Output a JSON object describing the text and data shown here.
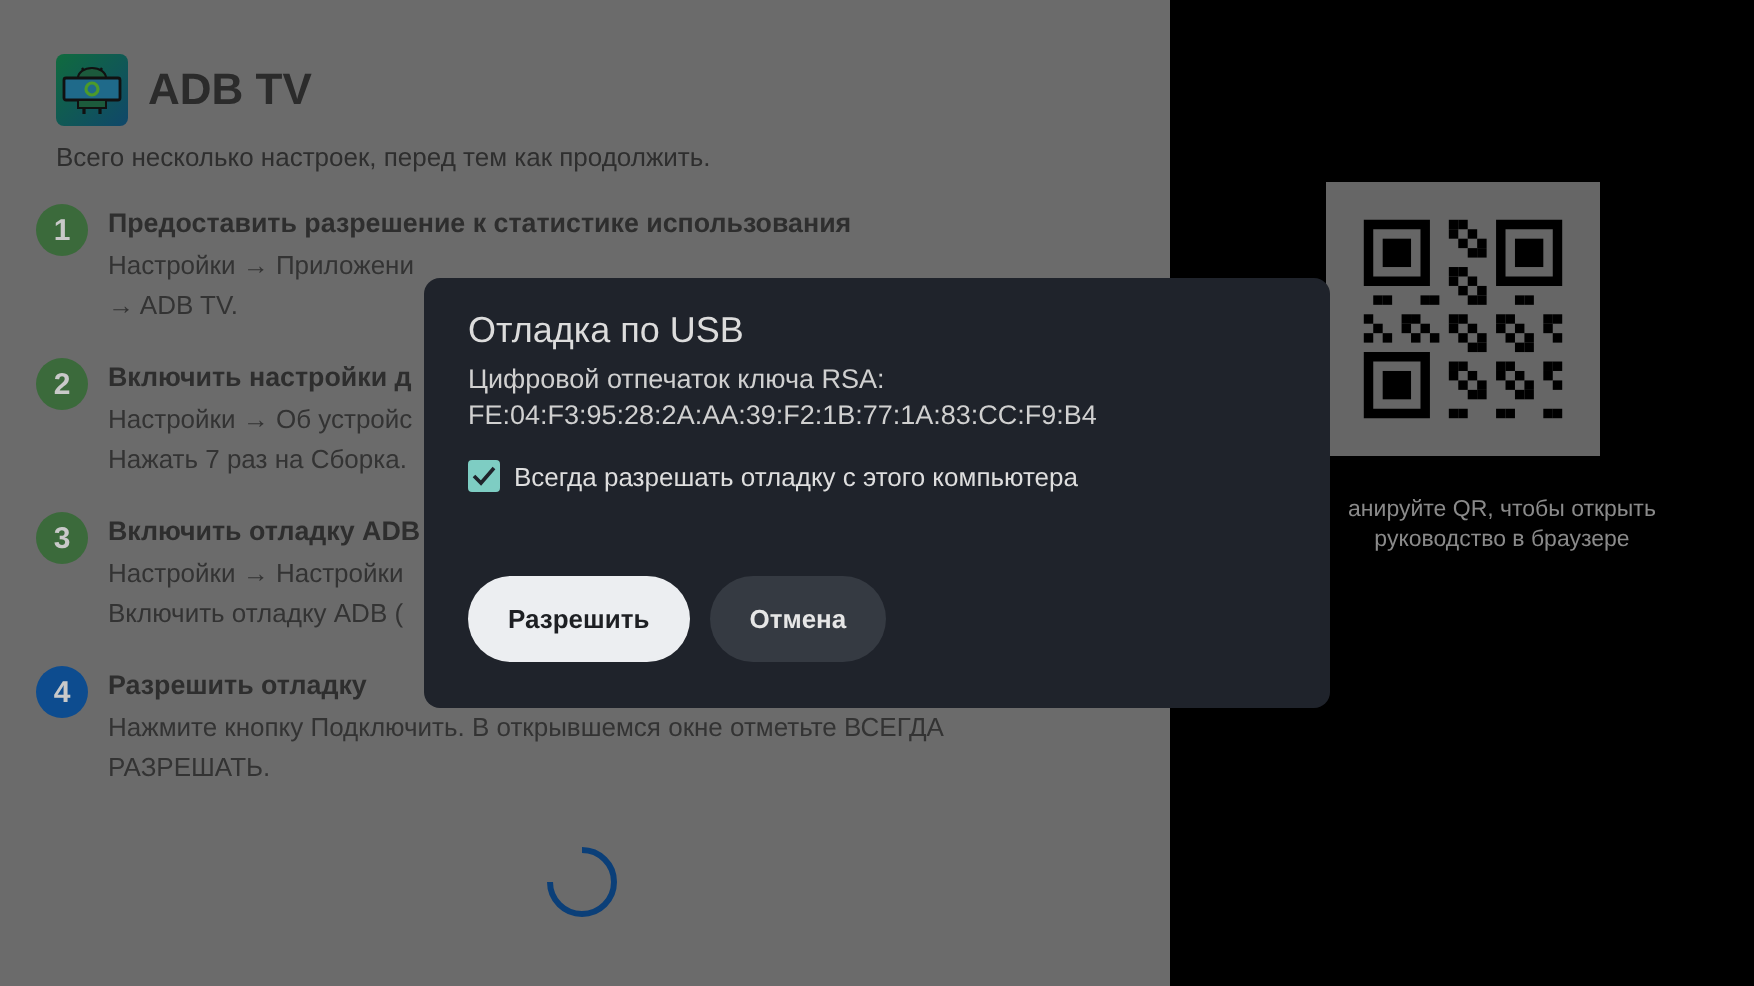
{
  "app": {
    "title": "ADB TV",
    "subtitle": "Всего несколько настроек, перед тем как продолжить."
  },
  "steps": [
    {
      "number": "1",
      "color": "#3b6a3b",
      "title": "Предоставить разрешение к статистике использования",
      "lines": [
        "Настройки → Приложени",
        "→ ADB TV."
      ]
    },
    {
      "number": "2",
      "color": "#3b6a3b",
      "title": "Включить настройки д",
      "lines": [
        "Настройки → Об устройс",
        "Нажать 7 раз на Сборка."
      ]
    },
    {
      "number": "3",
      "color": "#3b6a3b",
      "title": "Включить отладку ADB",
      "lines": [
        "Настройки → Настройки",
        "Включить отладку ADB ("
      ]
    },
    {
      "number": "4",
      "color": "#0d4c8f",
      "title": "Разрешить отладку",
      "lines": [
        "Нажмите кнопку Подключить. В открывшемся окне отметьте ВСЕГДА",
        "РАЗРЕШАТЬ."
      ]
    }
  ],
  "qr_caption": [
    "анируйте QR, чтобы открыть",
    "руководство в браузере"
  ],
  "dialog": {
    "title": "Отладка по USB",
    "message": [
      "Цифровой отпечаток ключа RSA:",
      "FE:04:F3:95:28:2A:AA:39:F2:1B:77:1A:83:CC:F9:B4"
    ],
    "checkbox": {
      "label": "Всегда разрешать отладку с этого компьютера",
      "checked": true
    },
    "buttons": [
      {
        "label": "Разрешить",
        "focused": true
      },
      {
        "label": "Отмена",
        "focused": false
      }
    ]
  }
}
